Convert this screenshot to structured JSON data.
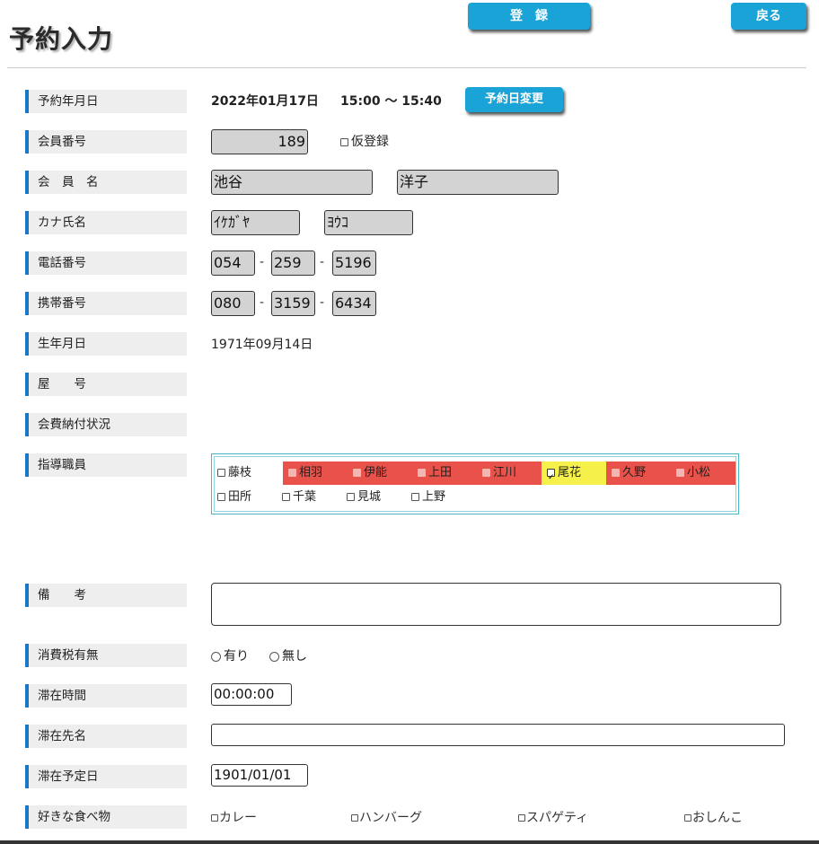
{
  "header": {
    "title": "予約入力",
    "register_button": "登　録",
    "back_button": "戻る"
  },
  "fields": {
    "reservation_date_label": "予約年月日",
    "reservation_date": "2022年01月17日",
    "reservation_time": "15:00 〜 15:40",
    "change_date_button": "予約日変更",
    "member_no_label": "会員番号",
    "member_no": "189",
    "provisional_label": "仮登録",
    "member_name_label": "会　員　名",
    "last_name": "池谷",
    "first_name": "洋子",
    "kana_label": "カナ氏名",
    "kana_last": "ｲｹｶﾞﾔ",
    "kana_first": "ﾖｳｺ",
    "phone_label": "電話番号",
    "phone": [
      "054",
      "259",
      "5196"
    ],
    "mobile_label": "携帯番号",
    "mobile": [
      "080",
      "3159",
      "6434"
    ],
    "birthday_label": "生年月日",
    "birthday": "1971年09月14日",
    "house_label": "屋　　号",
    "fee_status_label": "会費納付状況",
    "instructor_label": "指導職員",
    "instructors_row1": [
      "藤枝",
      "相羽",
      "伊能",
      "上田",
      "江川",
      "尾花",
      "久野",
      "小松"
    ],
    "instructors_row2": [
      "田所",
      "千葉",
      "見城",
      "上野"
    ],
    "remarks_label": "備　　考",
    "remarks": "",
    "tax_label": "消費税有無",
    "tax_yes": "有り",
    "tax_no": "無し",
    "stay_time_label": "滞在時間",
    "stay_time": "00:00:00",
    "stay_place_label": "滞在先名",
    "stay_place": "",
    "stay_date_label": "滞在予定日",
    "stay_date": "1901/01/01",
    "food_label": "好きな食べ物",
    "foods": [
      "カレー",
      "ハンバーグ",
      "スパゲティ",
      "おしんこ"
    ]
  },
  "colors": {
    "accent_button": "#1aa3d6",
    "label_bar": "#1a76c6",
    "instructor_busy": "#e8524a",
    "instructor_selected": "#f5f04a"
  },
  "icons": {
    "checkbox": "checkbox-icon",
    "radio": "radio-icon"
  }
}
